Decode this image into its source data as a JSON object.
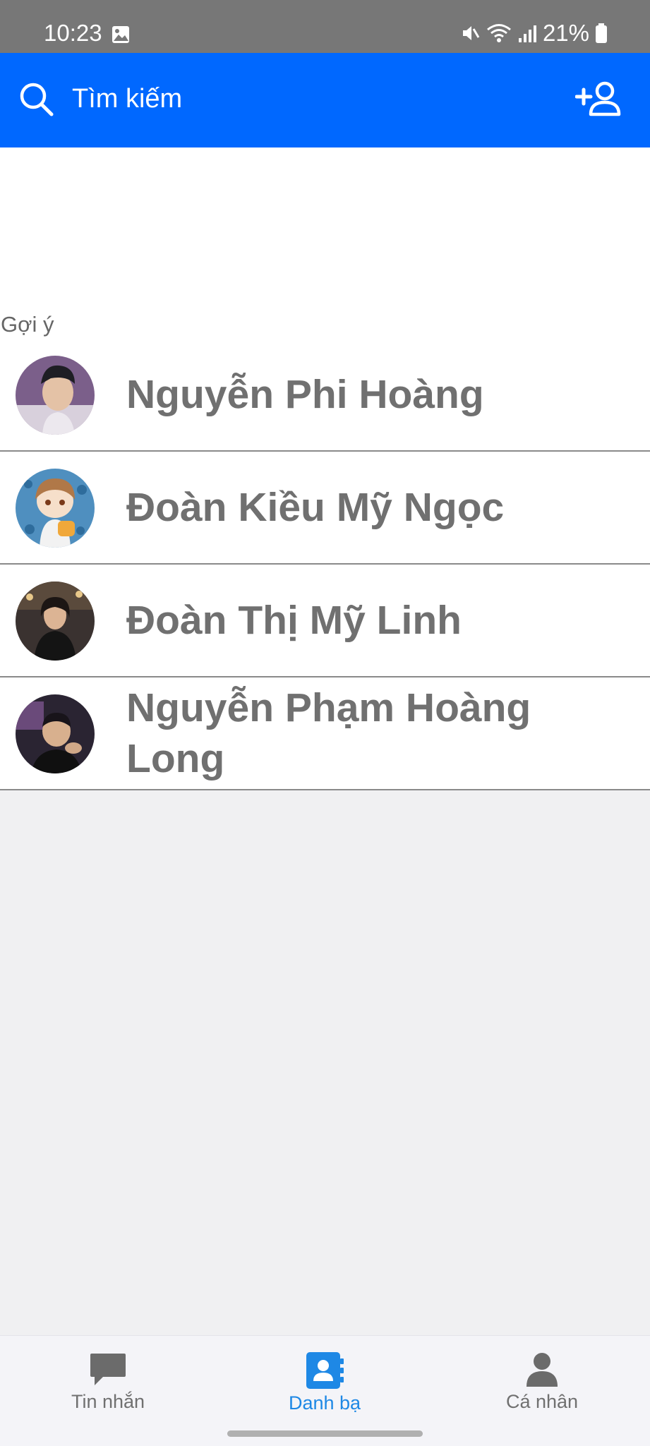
{
  "status_bar": {
    "time": "10:23",
    "battery": "21%",
    "icons": [
      "image-icon",
      "mute-icon",
      "wifi-icon",
      "signal-icon",
      "battery-icon"
    ]
  },
  "header": {
    "search_placeholder": "Tìm kiếm",
    "background_color": "#0068ff",
    "icons": [
      "search-icon",
      "add-friend-icon"
    ]
  },
  "suggestions": {
    "label": "Gợi ý",
    "contacts": [
      {
        "name": "Nguyễn Phi Hoàng",
        "avatar": "avatar-photo"
      },
      {
        "name": "Đoàn Kiều Mỹ Ngọc",
        "avatar": "avatar-illustration"
      },
      {
        "name": "Đoàn Thị Mỹ Linh",
        "avatar": "avatar-photo"
      },
      {
        "name": "Nguyễn Phạm Hoàng Long",
        "avatar": "avatar-photo"
      }
    ]
  },
  "bottom_nav": {
    "items": [
      {
        "label": "Tin nhắn",
        "icon": "chat-bubble-icon",
        "active": false
      },
      {
        "label": "Danh bạ",
        "icon": "contacts-book-icon",
        "active": true
      },
      {
        "label": "Cá nhân",
        "icon": "person-icon",
        "active": false
      }
    ],
    "active_color": "#1e88e5"
  }
}
